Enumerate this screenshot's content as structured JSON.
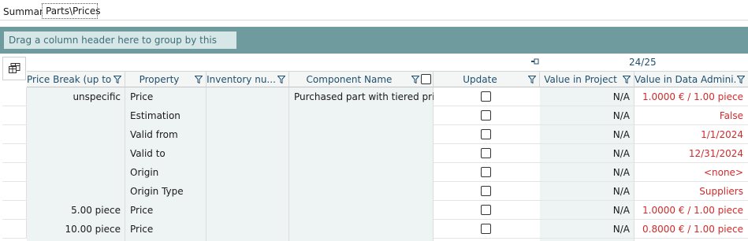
{
  "tabs": [
    {
      "label": "Summary",
      "active": false
    },
    {
      "label": "Parts\\Prices",
      "active": true
    }
  ],
  "group_hint": "Drag a column header here to group by this column.",
  "pager": "24/25",
  "columns": [
    "Price Break (up to)",
    "Property",
    "Inventory nu...",
    "Component Name",
    "Update",
    "Value in Project",
    "Value in Data Admini..."
  ],
  "rows": [
    {
      "price_break": "unspecific",
      "property": "Price",
      "inventory": "",
      "component": "Purchased part with tiered prices",
      "update": false,
      "value_project": "N/A",
      "value_admin": "1.0000 € / 1.00 piece"
    },
    {
      "price_break": "",
      "property": "Estimation",
      "inventory": "",
      "component": "",
      "update": false,
      "value_project": "N/A",
      "value_admin": "False"
    },
    {
      "price_break": "",
      "property": "Valid from",
      "inventory": "",
      "component": "",
      "update": false,
      "value_project": "N/A",
      "value_admin": "1/1/2024"
    },
    {
      "price_break": "",
      "property": "Valid to",
      "inventory": "",
      "component": "",
      "update": false,
      "value_project": "N/A",
      "value_admin": "12/31/2024"
    },
    {
      "price_break": "",
      "property": "Origin",
      "inventory": "",
      "component": "",
      "update": false,
      "value_project": "N/A",
      "value_admin": "<none>"
    },
    {
      "price_break": "",
      "property": "Origin Type",
      "inventory": "",
      "component": "",
      "update": false,
      "value_project": "N/A",
      "value_admin": "Suppliers"
    },
    {
      "price_break": "5.00 piece",
      "property": "Price",
      "inventory": "",
      "component": "",
      "update": false,
      "value_project": "N/A",
      "value_admin": "1.0000 € / 1.00 piece"
    },
    {
      "price_break": "10.00 piece",
      "property": "Price",
      "inventory": "",
      "component": "",
      "update": false,
      "value_project": "N/A",
      "value_admin": "0.8000 € / 1.00 piece"
    }
  ],
  "colors": {
    "accent_band": "#6f9a9e",
    "header_text": "#1f4f6e",
    "admin_value": "#d12a2a"
  }
}
